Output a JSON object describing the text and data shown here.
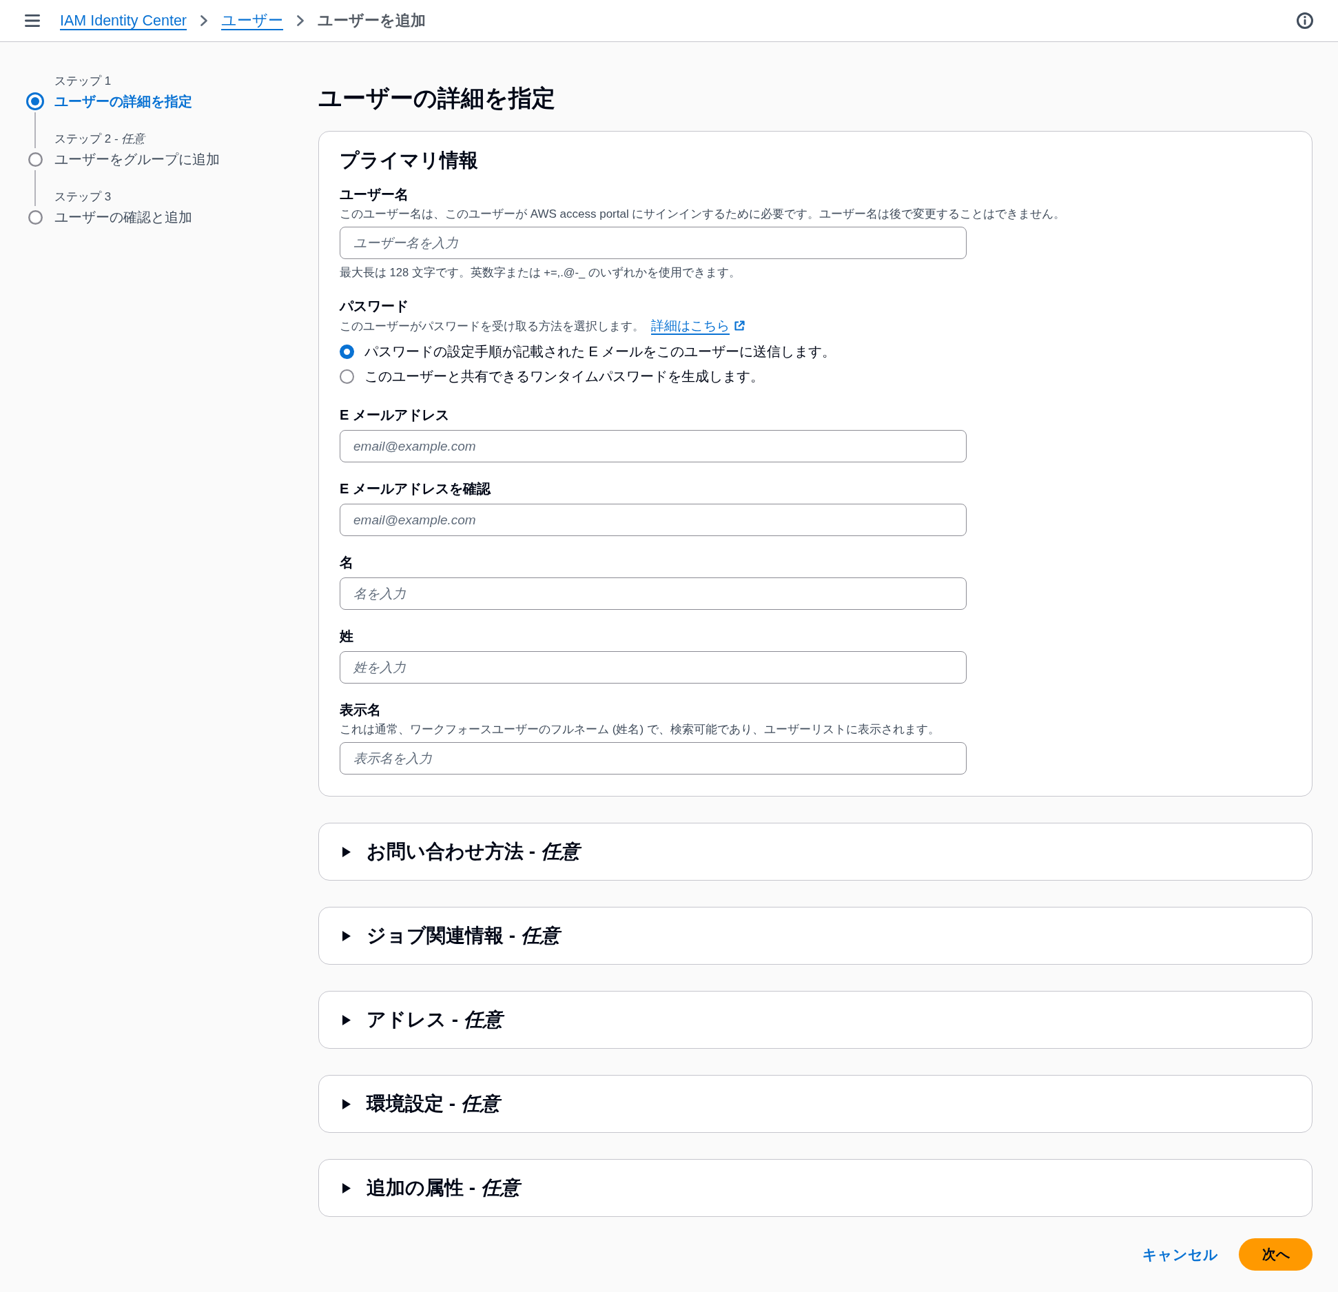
{
  "top_bar": {
    "breadcrumbs": [
      {
        "label": "IAM Identity Center",
        "current": false
      },
      {
        "label": "ユーザー",
        "current": false
      },
      {
        "label": "ユーザーを追加",
        "current": true
      }
    ]
  },
  "steps": [
    {
      "label": "ステップ 1",
      "title": "ユーザーの詳細を指定",
      "selected": true
    },
    {
      "label": "ステップ 2 - *任意*",
      "title": "ユーザーをグループに追加",
      "selected": false
    },
    {
      "label": "ステップ 3",
      "title": "ユーザーの確認と追加",
      "selected": false
    }
  ],
  "page_title": "ユーザーの詳細を指定",
  "primary_info": {
    "title": "プライマリ情報",
    "fields": [
      {
        "kind": "input",
        "label": "ユーザー名",
        "description": "このユーザー名は、このユーザーが AWS access portal にサインインするために必要です。ユーザー名は後で変更することはできません。",
        "placeholder": "ユーザー名を入力",
        "hint": "最大長は 128 文字です。英数字または +=,.@-_ のいずれかを使用できます。"
      },
      {
        "kind": "radio",
        "label": "パスワード",
        "description": "このユーザーがパスワードを受け取る方法を選択します。",
        "link": {
          "label": "詳細はこちら",
          "external": true
        },
        "options": [
          {
            "label": "パスワードの設定手順が記載された E メールをこのユーザーに送信します。",
            "selected": true
          },
          {
            "label": "このユーザーと共有できるワンタイムパスワードを生成します。",
            "selected": false
          }
        ]
      },
      {
        "kind": "input",
        "label": "E メールアドレス",
        "placeholder": "email@example.com"
      },
      {
        "kind": "input",
        "label": "E メールアドレスを確認",
        "placeholder": "email@example.com"
      },
      {
        "kind": "input",
        "label": "名",
        "placeholder": "名を入力"
      },
      {
        "kind": "input",
        "label": "姓",
        "placeholder": "姓を入力"
      },
      {
        "kind": "input",
        "label": "表示名",
        "description": "これは通常、ワークフォースユーザーのフルネーム (姓名) で、検索可能であり、ユーザーリストに表示されます。",
        "placeholder": "表示名を入力"
      }
    ]
  },
  "sections": [
    {
      "title": "お問い合わせ方法 - *任意*",
      "expanded": false
    },
    {
      "title": "ジョブ関連情報 - *任意*",
      "expanded": false
    },
    {
      "title": "アドレス - *任意*",
      "expanded": false
    },
    {
      "title": "環境設定 - *任意*",
      "expanded": false
    },
    {
      "title": "追加の属性 - *任意*",
      "expanded": false
    }
  ],
  "buttons": [
    {
      "label": "キャンセル",
      "kind": "link"
    },
    {
      "label": "次へ",
      "kind": "primary"
    }
  ]
}
